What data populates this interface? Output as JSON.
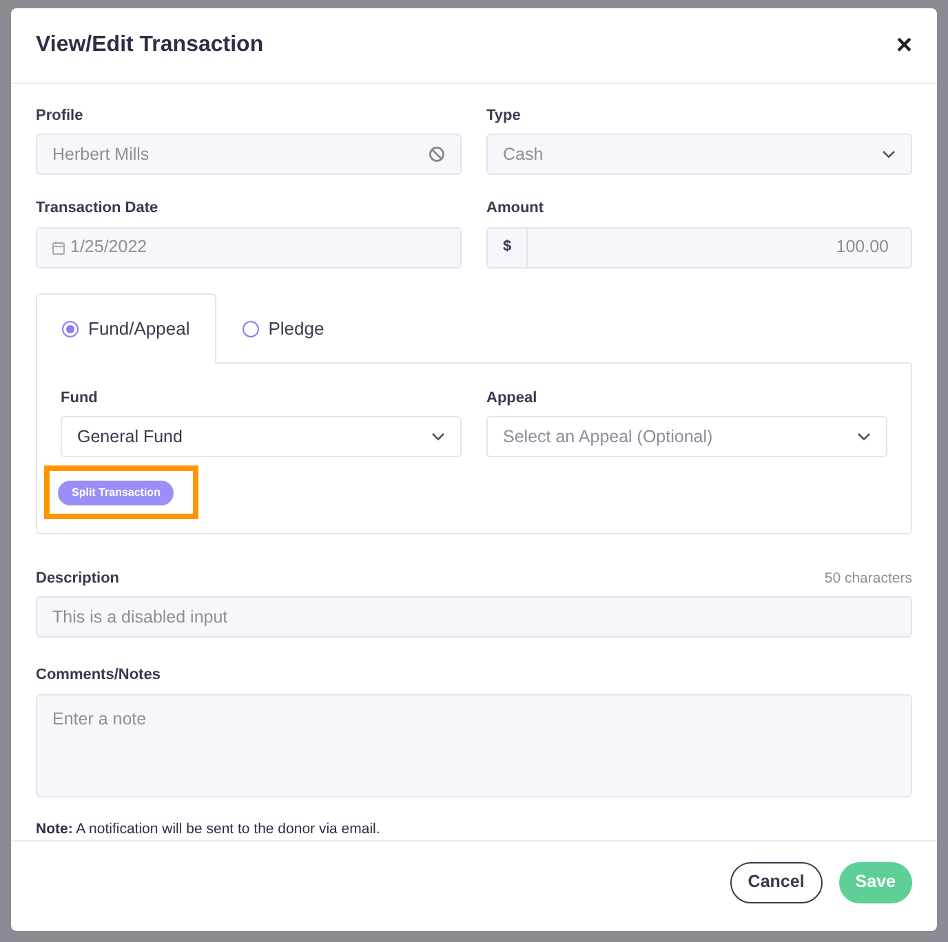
{
  "modal": {
    "title": "View/Edit Transaction",
    "close": "×"
  },
  "fields": [
    {
      "kind": "text",
      "label": "Profile",
      "value": "Herbert Mills",
      "disabled": true
    },
    {
      "kind": "select",
      "label": "Type",
      "value": "Cash",
      "disabled": true
    },
    {
      "kind": "date",
      "label": "Transaction Date",
      "value": "1/25/2022",
      "disabled": true
    },
    {
      "kind": "amount",
      "label": "Amount",
      "prefix": "$",
      "value": "100.00",
      "disabled": true
    }
  ],
  "tabs": [
    {
      "label": "Fund/Appeal",
      "selected": true
    },
    {
      "label": "Pledge",
      "selected": false
    }
  ],
  "tab_fields": [
    {
      "label": "Fund",
      "value": "General Fund"
    },
    {
      "label": "Appeal",
      "placeholder": "Select an Appeal (Optional)"
    }
  ],
  "split_button": {
    "label": "Split Transaction",
    "highlighted": true
  },
  "description": {
    "label": "Description",
    "counter": "50 characters",
    "placeholder": "This is a disabled input",
    "disabled": true
  },
  "comments": {
    "label": "Comments/Notes",
    "placeholder": "Enter a note"
  },
  "note": "**Note:** A notification will be sent to the donor via email.",
  "buttons": [
    {
      "kind": "outline",
      "label": "Cancel"
    },
    {
      "kind": "primary",
      "label": "Save"
    }
  ]
}
